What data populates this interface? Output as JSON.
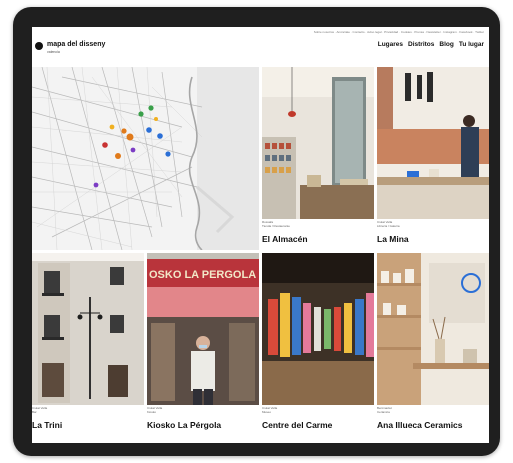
{
  "top_links": "Sobre nosotros · Anúnciate · Contacto · Aviso legal · Privacidad · Cookies · Prensa · Newsletter · Instagram · Facebook · Twitter",
  "brand": {
    "name": "mapa del disseny",
    "subtitle": "valencia"
  },
  "nav": [
    "Lugares",
    "Distritos",
    "Blog",
    "Tu lugar"
  ],
  "places": [
    {
      "name": "El Almacén",
      "district": "Russafa",
      "category": "Tienda / Restaurante"
    },
    {
      "name": "La Mina",
      "district": "Ciutat Vella",
      "category": "Librería / Galería"
    },
    {
      "name": "La Trini",
      "district": "Ciutat Vella",
      "category": "Bar"
    },
    {
      "name": "Kiosko La Pérgola",
      "district": "Ciutat Vella",
      "category": "Kiosko"
    },
    {
      "name": "Centre del Carme",
      "district": "Ciutat Vella",
      "category": "Museo"
    },
    {
      "name": "Ana Illueca Ceramics",
      "district": "Benimaclet",
      "category": "Cerámica"
    }
  ],
  "sign_text": "OSKO LA PERGOLA",
  "colors": {
    "tablet": "#1f1f1f",
    "pins": [
      "#e07a1a",
      "#2b6fd6",
      "#3aa04a",
      "#c83232",
      "#7c3cc4",
      "#f0b020"
    ]
  }
}
